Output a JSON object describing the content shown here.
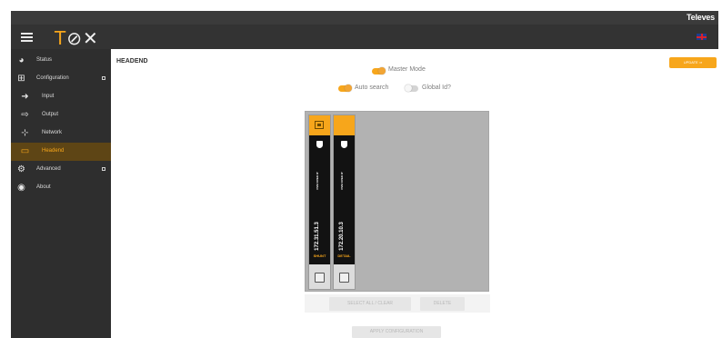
{
  "top_bar": {
    "brand": "Televes"
  },
  "header": {
    "logo_t": "T",
    "logo_rest": "⊘✕",
    "flag_icon": "uk-flag-icon"
  },
  "sidebar": {
    "items": [
      {
        "label": "Status",
        "icon": "dashboard-icon"
      },
      {
        "label": "Configuration",
        "icon": "config-icon"
      },
      {
        "label": "Input",
        "icon": "input-icon"
      },
      {
        "label": "Output",
        "icon": "output-icon"
      },
      {
        "label": "Network",
        "icon": "network-icon"
      },
      {
        "label": "Headend",
        "icon": "headend-icon"
      },
      {
        "label": "Advanced",
        "icon": "gears-icon"
      },
      {
        "label": "About",
        "icon": "eye-icon"
      }
    ]
  },
  "main": {
    "title": "HEADEND",
    "update_button": "UPDATE ⇒",
    "master_mode": {
      "label": "Master Mode",
      "on": true
    },
    "auto_search": {
      "label": "Auto search",
      "on": true
    },
    "global_id": {
      "label": "Global Id?",
      "on": false
    },
    "slots": [
      {
        "module_name": "DVB OVER IP",
        "ip": "172.31.51.3",
        "status": "SHUNT"
      },
      {
        "module_name": "DVB OVER IP",
        "ip": "172.20.10.3",
        "status": "DETAIL"
      }
    ],
    "buttons": {
      "select": "SELECT ALL / CLEAR",
      "delete": "DELETE",
      "apply": "APPLY CONFIGURATION"
    }
  },
  "colors": {
    "accent": "#f7a61b",
    "sidebar": "#2e2e2e",
    "header": "#333333"
  }
}
